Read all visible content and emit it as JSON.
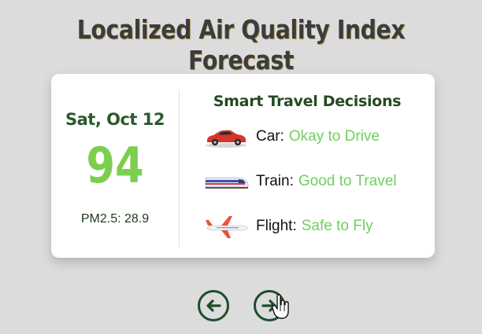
{
  "page": {
    "title": "Localized Air Quality Index Forecast"
  },
  "forecast": {
    "date": "Sat, Oct 12",
    "aqi": "94",
    "pm25": "PM2.5: 28.9"
  },
  "travel": {
    "heading": "Smart Travel Decisions",
    "items": [
      {
        "icon": "car-icon",
        "mode": "Car:",
        "status": "Okay to Drive"
      },
      {
        "icon": "train-icon",
        "mode": "Train:",
        "status": "Good to Travel"
      },
      {
        "icon": "airplane-icon",
        "mode": "Flight:",
        "status": "Safe to Fly"
      }
    ]
  },
  "nav": {
    "prev_icon": "arrow-left-circle-icon",
    "next_icon": "arrow-right-circle-icon"
  },
  "colors": {
    "background": "#dcdcdc",
    "aqi_green": "#7ccf4e",
    "status_green": "#6fcf5e",
    "dark_green": "#234a23",
    "nav_dark": "#1f4d2a"
  }
}
